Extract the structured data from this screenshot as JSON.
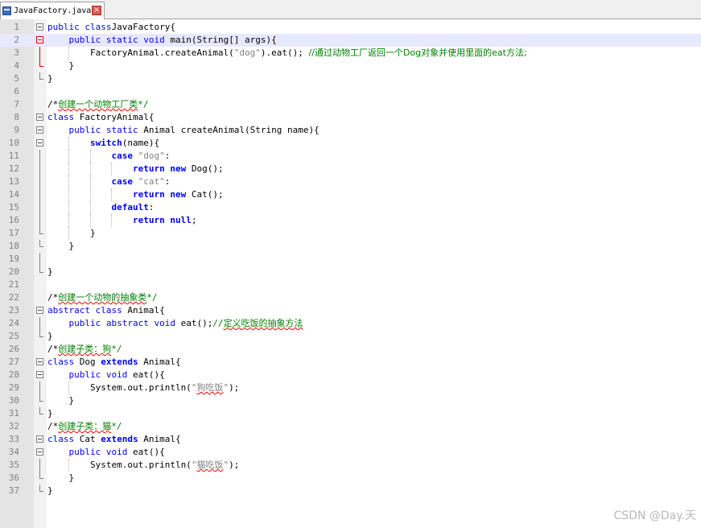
{
  "tab": {
    "filename": "JavaFactory.java",
    "close_glyph": "×"
  },
  "watermark": "CSDN @Day.天",
  "colors": {
    "keyword": "#0000ff",
    "string": "#808080",
    "comment": "#008000",
    "current_line": "#e8e8ff",
    "fold_active": "#e00000"
  },
  "lines": [
    {
      "n": "1",
      "fold": "open",
      "segs": [
        [
          "kw",
          "public class"
        ],
        [
          "",
          "JavaFactory{"
        ]
      ]
    },
    {
      "n": "2",
      "fold": "open-active",
      "current": true,
      "segs": [
        [
          "",
          "    "
        ],
        [
          "kw",
          "public static void"
        ],
        [
          "",
          " main(String[] args){"
        ]
      ]
    },
    {
      "n": "3",
      "fold": "line-active",
      "segs": [
        [
          "",
          "        FactoryAnimal.createAnimal("
        ],
        [
          "str",
          "\"dog\""
        ],
        [
          "",
          ").eat(); "
        ],
        [
          "cmt",
          "//通过动物工厂返回一个Dog对象并使用里面的eat方法;"
        ]
      ]
    },
    {
      "n": "4",
      "fold": "end-active",
      "segs": [
        [
          "",
          "    }"
        ]
      ]
    },
    {
      "n": "5",
      "fold": "end",
      "segs": [
        [
          "",
          "}"
        ]
      ]
    },
    {
      "n": "6",
      "fold": "",
      "segs": []
    },
    {
      "n": "7",
      "fold": "",
      "segs": [
        [
          "",
          "/*"
        ],
        [
          "cmtsq",
          "创建一个动物工厂类"
        ],
        [
          "cmt",
          "*/"
        ]
      ]
    },
    {
      "n": "8",
      "fold": "open",
      "segs": [
        [
          "kw",
          "class"
        ],
        [
          "",
          " FactoryAnimal{"
        ]
      ]
    },
    {
      "n": "9",
      "fold": "open",
      "segs": [
        [
          "",
          "    "
        ],
        [
          "kw",
          "public static"
        ],
        [
          "",
          " Animal createAnimal(String name){"
        ]
      ]
    },
    {
      "n": "10",
      "fold": "open",
      "segs": [
        [
          "",
          "        "
        ],
        [
          "kwb",
          "switch"
        ],
        [
          "",
          "(name){"
        ]
      ]
    },
    {
      "n": "11",
      "fold": "line",
      "segs": [
        [
          "",
          "            "
        ],
        [
          "kwb",
          "case"
        ],
        [
          "",
          " "
        ],
        [
          "str",
          "\"dog\""
        ],
        [
          "",
          ":"
        ]
      ]
    },
    {
      "n": "12",
      "fold": "line",
      "segs": [
        [
          "",
          "                "
        ],
        [
          "kwb",
          "return"
        ],
        [
          "",
          " "
        ],
        [
          "kwb",
          "new"
        ],
        [
          "",
          " Dog();"
        ]
      ]
    },
    {
      "n": "13",
      "fold": "line",
      "segs": [
        [
          "",
          "            "
        ],
        [
          "kwb",
          "case"
        ],
        [
          "",
          " "
        ],
        [
          "str",
          "\"cat\""
        ],
        [
          "",
          ":"
        ]
      ]
    },
    {
      "n": "14",
      "fold": "line",
      "segs": [
        [
          "",
          "                "
        ],
        [
          "kwb",
          "return"
        ],
        [
          "",
          " "
        ],
        [
          "kwb",
          "new"
        ],
        [
          "",
          " Cat();"
        ]
      ]
    },
    {
      "n": "15",
      "fold": "line",
      "segs": [
        [
          "",
          "            "
        ],
        [
          "kwb",
          "default"
        ],
        [
          "",
          ":"
        ]
      ]
    },
    {
      "n": "16",
      "fold": "line",
      "segs": [
        [
          "",
          "                "
        ],
        [
          "kwb",
          "return null"
        ],
        [
          "",
          ";"
        ]
      ]
    },
    {
      "n": "17",
      "fold": "end",
      "segs": [
        [
          "",
          "        }"
        ]
      ]
    },
    {
      "n": "18",
      "fold": "end",
      "segs": [
        [
          "",
          "    }"
        ]
      ]
    },
    {
      "n": "19",
      "fold": "line",
      "segs": []
    },
    {
      "n": "20",
      "fold": "end",
      "segs": [
        [
          "",
          "}"
        ]
      ]
    },
    {
      "n": "21",
      "fold": "",
      "segs": []
    },
    {
      "n": "22",
      "fold": "",
      "segs": [
        [
          "",
          "/*"
        ],
        [
          "cmtsq",
          "创建一个动物的抽象类"
        ],
        [
          "cmt",
          "*/"
        ]
      ]
    },
    {
      "n": "23",
      "fold": "open",
      "segs": [
        [
          "kw",
          "abstract class"
        ],
        [
          "",
          " Animal{"
        ]
      ]
    },
    {
      "n": "24",
      "fold": "line",
      "segs": [
        [
          "",
          "    "
        ],
        [
          "kw",
          "public abstract void"
        ],
        [
          "",
          " eat();"
        ],
        [
          "cmt",
          "//"
        ],
        [
          "cmtsq",
          "定义吃饭的抽象方法"
        ]
      ]
    },
    {
      "n": "25",
      "fold": "end",
      "segs": [
        [
          "",
          "}"
        ]
      ]
    },
    {
      "n": "26",
      "fold": "",
      "segs": [
        [
          "",
          "/*"
        ],
        [
          "cmtsq",
          "创建子类：狗"
        ],
        [
          "cmt",
          "*/"
        ]
      ]
    },
    {
      "n": "27",
      "fold": "open",
      "segs": [
        [
          "kw",
          "class"
        ],
        [
          "",
          " Dog "
        ],
        [
          "kwb",
          "extends"
        ],
        [
          "",
          " Animal{"
        ]
      ]
    },
    {
      "n": "28",
      "fold": "open",
      "segs": [
        [
          "",
          "    "
        ],
        [
          "kw",
          "public void"
        ],
        [
          "",
          " eat(){"
        ]
      ]
    },
    {
      "n": "29",
      "fold": "line",
      "segs": [
        [
          "",
          "        System.out.println("
        ],
        [
          "str",
          "\""
        ],
        [
          "strsq",
          "狗吃饭"
        ],
        [
          "str",
          "\""
        ],
        [
          "",
          ");"
        ]
      ]
    },
    {
      "n": "30",
      "fold": "end",
      "segs": [
        [
          "",
          "    }"
        ]
      ]
    },
    {
      "n": "31",
      "fold": "end",
      "segs": [
        [
          "",
          "}"
        ]
      ]
    },
    {
      "n": "32",
      "fold": "",
      "segs": [
        [
          "",
          "/*"
        ],
        [
          "cmtsq",
          "创建子类：猫"
        ],
        [
          "cmt",
          "*/"
        ]
      ]
    },
    {
      "n": "33",
      "fold": "open",
      "segs": [
        [
          "kw",
          "class"
        ],
        [
          "",
          " Cat "
        ],
        [
          "kwb",
          "extends"
        ],
        [
          "",
          " Animal{"
        ]
      ]
    },
    {
      "n": "34",
      "fold": "open",
      "segs": [
        [
          "",
          "    "
        ],
        [
          "kw",
          "public void"
        ],
        [
          "",
          " eat(){"
        ]
      ]
    },
    {
      "n": "35",
      "fold": "line",
      "segs": [
        [
          "",
          "        System.out.println("
        ],
        [
          "str",
          "\""
        ],
        [
          "strsq",
          "猫吃饭"
        ],
        [
          "str",
          "\""
        ],
        [
          "",
          ");"
        ]
      ]
    },
    {
      "n": "36",
      "fold": "end",
      "segs": [
        [
          "",
          "    }"
        ]
      ]
    },
    {
      "n": "37",
      "fold": "end",
      "segs": [
        [
          "",
          "}"
        ]
      ]
    }
  ]
}
